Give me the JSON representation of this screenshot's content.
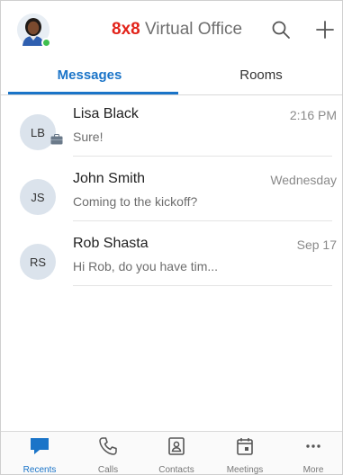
{
  "header": {
    "brand_bold": "8x8",
    "brand_rest": " Virtual Office",
    "search_icon": "search-icon",
    "add_icon": "plus-icon"
  },
  "tabs": [
    {
      "label": "Messages",
      "active": true
    },
    {
      "label": "Rooms",
      "active": false
    }
  ],
  "conversations": [
    {
      "initials": "LB",
      "name": "Lisa Black",
      "snippet": "Sure!",
      "time": "2:16 PM",
      "device_icon": "briefcase-icon"
    },
    {
      "initials": "JS",
      "name": "John Smith",
      "snippet": "Coming to the kickoff?",
      "time": "Wednesday"
    },
    {
      "initials": "RS",
      "name": "Rob Shasta",
      "snippet": "Hi Rob, do you have tim...",
      "time": "Sep 17"
    }
  ],
  "bottom_nav": [
    {
      "label": "Recents",
      "icon": "chat-bubble-icon",
      "active": true
    },
    {
      "label": "Calls",
      "icon": "phone-icon",
      "active": false
    },
    {
      "label": "Contacts",
      "icon": "contact-card-icon",
      "active": false
    },
    {
      "label": "Meetings",
      "icon": "calendar-icon",
      "active": false
    },
    {
      "label": "More",
      "icon": "more-dots-icon",
      "active": false
    }
  ],
  "colors": {
    "accent": "#1a74c8",
    "brand_red": "#e2231a",
    "presence_online": "#3fbf4f"
  }
}
